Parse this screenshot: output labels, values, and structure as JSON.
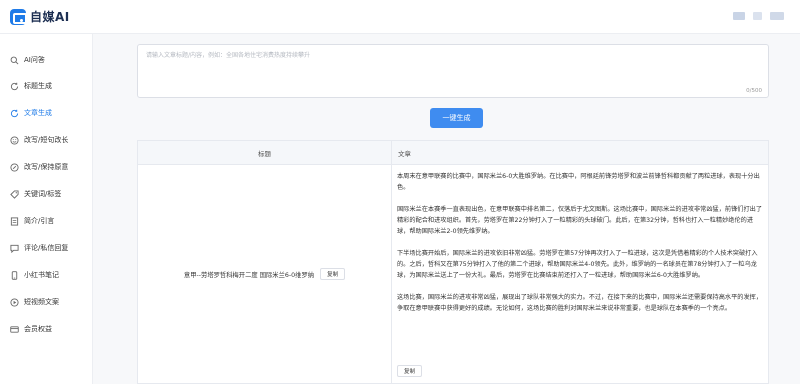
{
  "header": {
    "logo_text": "自媒AI"
  },
  "sidebar": {
    "items": [
      {
        "label": "AI问答",
        "icon": "search-icon"
      },
      {
        "label": "标题生成",
        "icon": "refresh-icon"
      },
      {
        "label": "文章生成",
        "icon": "refresh-icon",
        "active": true
      },
      {
        "label": "改写/短句改长",
        "icon": "smile-icon"
      },
      {
        "label": "改写/保持原意",
        "icon": "edit-icon"
      },
      {
        "label": "关键词/标签",
        "icon": "tag-icon"
      },
      {
        "label": "简介/引言",
        "icon": "document-icon"
      },
      {
        "label": "评论/私信回复",
        "icon": "comment-icon"
      },
      {
        "label": "小红书笔记",
        "icon": "phone-icon"
      },
      {
        "label": "短视频文案",
        "icon": "video-icon"
      },
      {
        "label": "会员权益",
        "icon": "card-icon"
      }
    ]
  },
  "input": {
    "placeholder": "请输入文章标题/内容，例如：全国各地住宅消费热度持续攀升",
    "counter": "0/500"
  },
  "generate_label": "一键生成",
  "table": {
    "col_title": "标题",
    "col_article": "文章",
    "row": {
      "title": "意甲--劳塔罗哲科梅开二度 国际米兰6-0维罗纳",
      "copy_label": "复制",
      "paragraphs": [
        "本周末在意甲联赛的比赛中，国际米兰6-0大胜维罗纳。在比赛中，阿根廷前锋劳塔罗和波兰前锋哲科都贡献了两粒进球，表现十分出色。",
        "国际米兰在本赛季一直表现出色，在意甲联赛中排名第二，仅落后于尤文图斯。这场比赛中，国际米兰的进攻非常凶猛，前锋们打出了精彩的配合和进攻组织。首先，劳塔罗在第22分钟打入了一粒精彩的头球破门。此后，在第32分钟，哲科也打入一粒精妙绝伦的进球，帮助国际米兰2-0领先维罗纳。",
        "下半场比赛开始后，国际米兰的进攻依旧非常凶猛。劳塔罗在第57分钟再次打入了一粒进球，这次是凭借着精彩的个人技术突破打入的。之后，哲科又在第75分钟打入了他的第二个进球，帮助国际米兰4-0领先。此外，维罗纳的一名球员在第78分钟打入了一粒乌龙球，为国际米兰送上了一份大礼。最后，劳塔罗在比赛结束前还打入了一粒进球，帮助国际米兰6-0大胜维罗纳。",
        "这场比赛，国际米兰的进攻非常凶猛，展现出了球队非常强大的实力。不过，在接下来的比赛中，国际米兰还需要保持高水平的发挥，争取在意甲联赛中获得更好的成绩。无论如何，这场比赛的胜利对国际米兰来说非常重要，也是球队在本赛季的一个亮点。"
      ],
      "article_copy_label": "复制"
    }
  },
  "colors": {
    "accent": "#1f7be8",
    "button": "#3f8cf0"
  }
}
